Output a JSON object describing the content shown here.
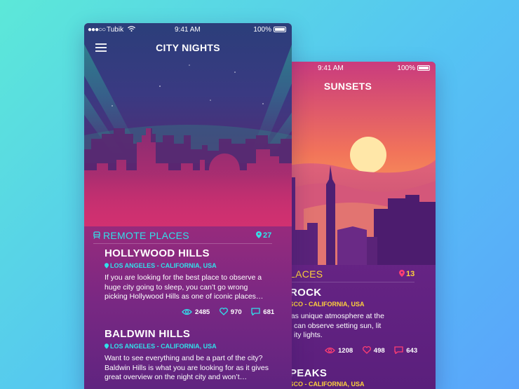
{
  "colors": {
    "accent_cyan": "#31e0ea",
    "accent_gold": "#ffd23a",
    "sunset_pink": "#ff3e73"
  },
  "city_nights": {
    "status": {
      "carrier": "Tubik",
      "time": "9:41 AM",
      "battery": "100%"
    },
    "title": "CITY NIGHTS",
    "section": {
      "label": "REMOTE PLACES",
      "count": "27"
    },
    "places": [
      {
        "name": "HOLLYWOOD HILLS",
        "location": "LOS ANGELES - CALIFORNIA, USA",
        "description": "If you are looking for the best place to observe a huge city going to sleep, you can’t go wrong picking Hollywood Hills as one of iconic places…",
        "views": "2485",
        "likes": "970",
        "comments": "681"
      },
      {
        "name": "BALDWIN HILLS",
        "location": "LOS ANGELES - CALIFORNIA, USA",
        "description": "Want to see everything and be a part of the city? Baldwin Hills is what you are looking for as it gives great overview on the night city and won’t…"
      }
    ]
  },
  "sunsets": {
    "status": {
      "time": "9:41 AM",
      "battery": "100%"
    },
    "title": "SUNSETS",
    "section": {
      "label": "LACES",
      "count": "13"
    },
    "places": [
      {
        "name": "ROCK",
        "location": "ISCO - CALIFORNIA, USA",
        "lines": [
          "has unique atmosphere at the",
          "can observe setting sun, lit",
          "ity lights."
        ],
        "views": "1208",
        "likes": "498",
        "comments": "643"
      },
      {
        "name": "PEAKS",
        "location": "ISCO - CALIFORNIA, USA"
      }
    ]
  }
}
